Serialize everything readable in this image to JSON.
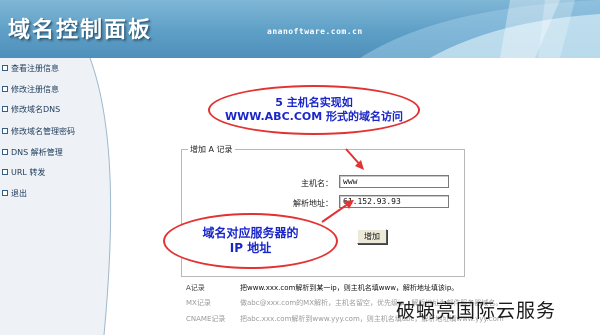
{
  "header": {
    "title": "域名控制面板",
    "site": "ananoftware.com.cn"
  },
  "sidebar": {
    "items": [
      {
        "label": "查看注册信息"
      },
      {
        "label": "修改注册信息"
      },
      {
        "label": "修改域名DNS"
      },
      {
        "label": "修改域名管理密码"
      },
      {
        "label": "DNS 解析管理"
      },
      {
        "label": "URL 转发"
      },
      {
        "label": "退出"
      }
    ]
  },
  "form": {
    "legend": "增加 A 记录",
    "host_label": "主机名：",
    "host_value": "www",
    "ip_label": "解析地址：",
    "ip_value": "61.152.93.93",
    "submit_label": "增加"
  },
  "annotations": {
    "note1_line1": "5  主机名实现如",
    "note1_line2": "WWW.ABC.COM 形式的域名访问",
    "note2_line1": "域名对应服务器的",
    "note2_line2": "IP 地址"
  },
  "records": [
    {
      "type": "A记录",
      "desc": "把www.xxx.com解析到某一ip，则主机名填www，解析地址填该ip。"
    },
    {
      "type": "MX记录",
      "desc": "做abc@xxx.com的MX解析，主机名留空，优先级ip，解析地址为邮件服务器域名。"
    },
    {
      "type": "CNAME记录",
      "desc": "把abc.xxx.com解析到www.yyy.com，则主机名填abc，解析地址填www.yyy.com"
    }
  ],
  "watermark": "破蜗亮国际云服务",
  "colors": {
    "header": "#5e9fc6",
    "sidebar": "#eef2f6",
    "annotation_border": "#e23232",
    "annotation_text": "#1a26c8"
  }
}
